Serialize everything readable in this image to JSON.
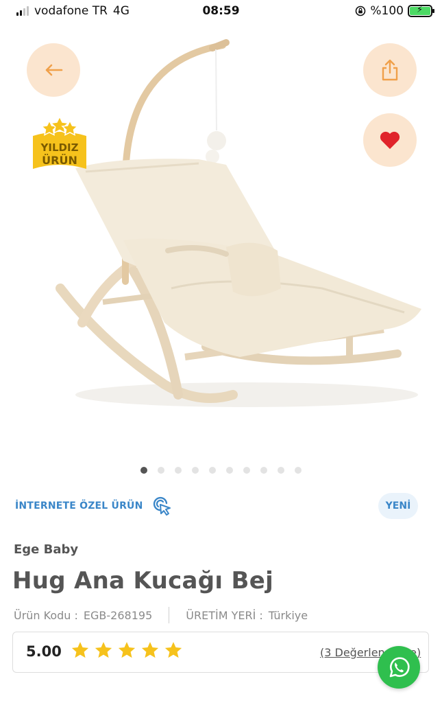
{
  "status_bar": {
    "carrier": "vodafone TR",
    "network": "4G",
    "time": "08:59",
    "battery": "%100"
  },
  "hero": {
    "badge_line1": "YILDIZ",
    "badge_line2": "ÜRÜN",
    "image_icon": "baby-rocker-image",
    "slide_count": 10,
    "active_slide": 1
  },
  "product": {
    "online_label": "İNTERNETE ÖZEL ÜRÜN",
    "new_badge": "YENİ",
    "brand": "Ege Baby",
    "title": "Hug Ana Kucağı Bej",
    "code_label": "Ürün Kodu :",
    "code_value": "EGB-268195",
    "origin_label": "ÜRETİM YERİ :",
    "origin_value": "Türkiye",
    "rating": "5.00",
    "stars": 5,
    "reviews_link": "(3 Değerlendirme)"
  },
  "colors": {
    "accent_button_bg": "#fbe5cf",
    "accent_orange": "#f0a04a",
    "heart_red": "#e0242b",
    "link_blue": "#3a86c8",
    "star_yellow": "#f6c21c",
    "whatsapp_green": "#2fbf4e"
  }
}
